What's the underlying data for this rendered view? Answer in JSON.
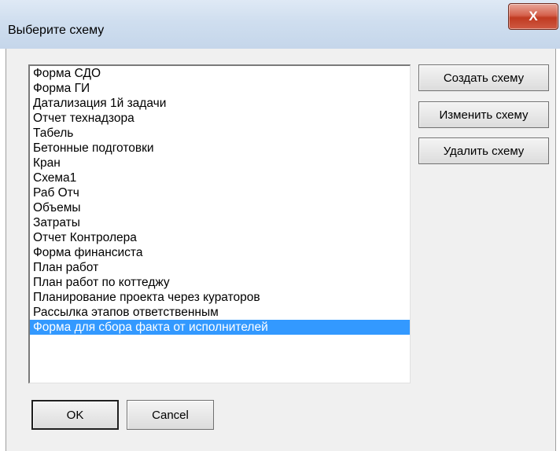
{
  "window": {
    "title": "Выберите схему",
    "close_glyph": "X"
  },
  "list": {
    "items": [
      "Форма СДО",
      "Форма ГИ",
      "Датализация 1й задачи",
      "Отчет технадзора",
      "Табель",
      "Бетонные подготовки",
      "Кран",
      "Схема1",
      "Раб Отч",
      "Объемы",
      "Затраты",
      "Отчет Контролера",
      "Форма финансиста",
      "План работ",
      "План работ по коттеджу",
      "Планирование проекта через кураторов",
      "Рассылка этапов ответственным",
      "Форма для сбора факта от исполнителей"
    ],
    "selected_index": 17
  },
  "buttons": {
    "create": "Создать схему",
    "edit": "Изменить схему",
    "delete": "Удалить схему",
    "ok": "OK",
    "cancel": "Cancel"
  },
  "colors": {
    "selection": "#3399ff",
    "close_button": "#c9452d"
  }
}
